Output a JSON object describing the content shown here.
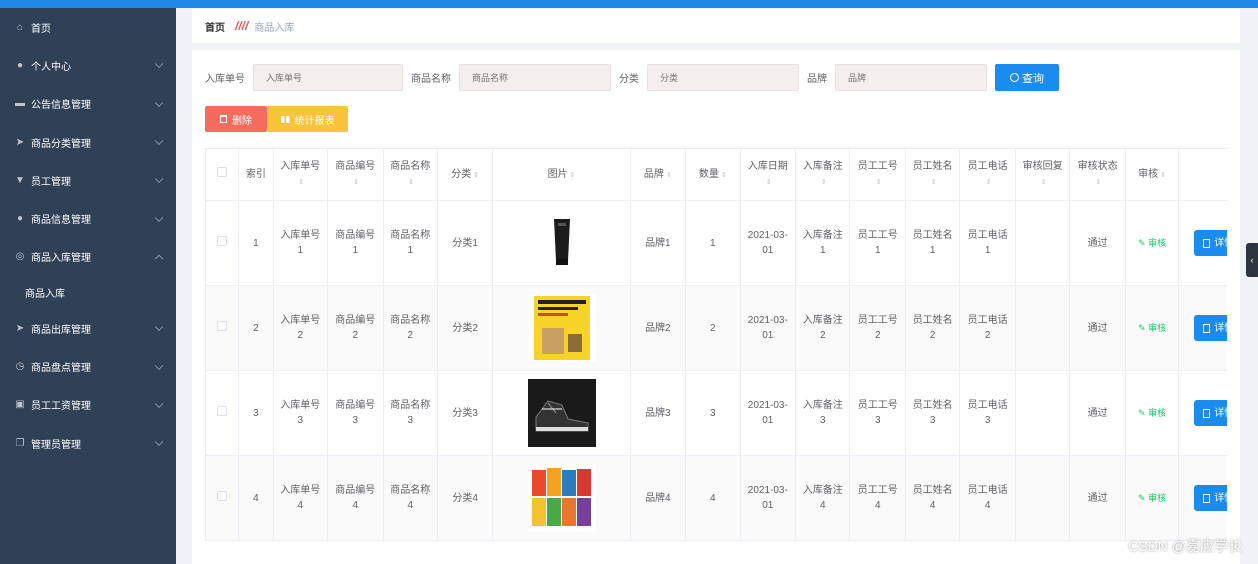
{
  "sidebar": {
    "items": [
      {
        "label": "首页",
        "icon": "home-icon",
        "glyph": "⌂",
        "chevron": false
      },
      {
        "label": "个人中心",
        "icon": "user-icon",
        "glyph": "●",
        "chevron": true
      },
      {
        "label": "公告信息管理",
        "icon": "briefcase-icon",
        "glyph": "▬",
        "chevron": true
      },
      {
        "label": "商品分类管理",
        "icon": "send-icon",
        "glyph": "➤",
        "chevron": true
      },
      {
        "label": "员工管理",
        "icon": "sign-icon",
        "glyph": "▼",
        "chevron": true
      },
      {
        "label": "商品信息管理",
        "icon": "user-icon",
        "glyph": "●",
        "chevron": true
      },
      {
        "label": "商品入库管理",
        "icon": "help-icon",
        "glyph": "◎",
        "chevron": true,
        "open": true
      },
      {
        "label": "商品出库管理",
        "icon": "send-icon",
        "glyph": "➤",
        "chevron": true
      },
      {
        "label": "商品盘点管理",
        "icon": "clock-icon",
        "glyph": "◷",
        "chevron": true
      },
      {
        "label": "员工工资管理",
        "icon": "postcard-icon",
        "glyph": "▣",
        "chevron": true
      },
      {
        "label": "管理员管理",
        "icon": "copy-icon",
        "glyph": "❐",
        "chevron": true
      }
    ],
    "subitem": "商品入库"
  },
  "breadcrumb": {
    "home": "首页",
    "separator": "////",
    "current": "商品入库"
  },
  "search": {
    "fields": [
      {
        "label": "入库单号",
        "placeholder": "入库单号"
      },
      {
        "label": "商品名称",
        "placeholder": "商品名称"
      },
      {
        "label": "分类",
        "placeholder": "分类"
      },
      {
        "label": "品牌",
        "placeholder": "品牌"
      }
    ],
    "query_label": "查询"
  },
  "actions": {
    "delete_label": "删除",
    "stats_label": "统计报表"
  },
  "table": {
    "headers": [
      "索引",
      "入库单号",
      "商品编号",
      "商品名称",
      "分类",
      "图片",
      "品牌",
      "数量",
      "入库日期",
      "入库备注",
      "员工工号",
      "员工姓名",
      "员工电话",
      "审核回复",
      "审核状态",
      "审核"
    ],
    "audit_label": "审核",
    "detail_label": "详情",
    "rows": [
      {
        "index": "1",
        "in_no": "入库单号1",
        "prod_no": "商品编号1",
        "prod_name": "商品名称1",
        "category": "分类1",
        "image": "cosmetic-tube",
        "brand": "品牌1",
        "qty": "1",
        "date": "2021-03-01",
        "remark": "入库备注1",
        "emp_no": "员工工号1",
        "emp_name": "员工姓名1",
        "emp_phone": "员工电话1",
        "reply": "",
        "status": "通过"
      },
      {
        "index": "2",
        "in_no": "入库单号2",
        "prod_no": "商品编号2",
        "prod_name": "商品名称2",
        "category": "分类2",
        "image": "book-cover",
        "brand": "品牌2",
        "qty": "2",
        "date": "2021-03-01",
        "remark": "入库备注2",
        "emp_no": "员工工号2",
        "emp_name": "员工姓名2",
        "emp_phone": "员工电话2",
        "reply": "",
        "status": "通过"
      },
      {
        "index": "3",
        "in_no": "入库单号3",
        "prod_no": "商品编号3",
        "prod_name": "商品名称3",
        "category": "分类3",
        "image": "sneakers",
        "brand": "品牌3",
        "qty": "3",
        "date": "2021-03-01",
        "remark": "入库备注3",
        "emp_no": "员工工号3",
        "emp_name": "员工姓名3",
        "emp_phone": "员工电话3",
        "reply": "",
        "status": "通过"
      },
      {
        "index": "4",
        "in_no": "入库单号4",
        "prod_no": "商品编号4",
        "prod_name": "商品名称4",
        "category": "分类4",
        "image": "snack-packs",
        "brand": "品牌4",
        "qty": "4",
        "date": "2021-03-01",
        "remark": "入库备注4",
        "emp_no": "员工工号4",
        "emp_name": "员工姓名4",
        "emp_phone": "员工电话4",
        "reply": "",
        "status": "通过"
      }
    ]
  },
  "watermark": "CSDN @嘉应学长",
  "colors": {
    "sidebar": "#304156",
    "primary": "#1a8cf0",
    "danger": "#f56c5d",
    "warning": "#f9c33c",
    "success": "#13ce66"
  }
}
